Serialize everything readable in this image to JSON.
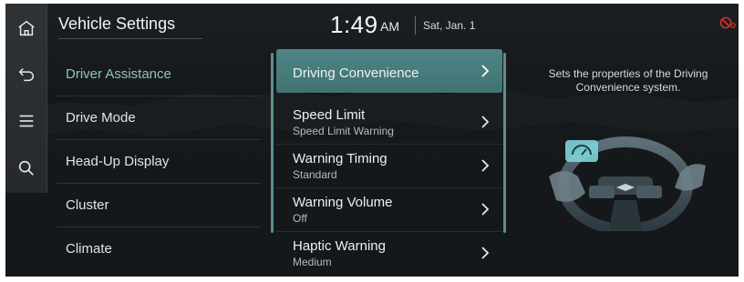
{
  "header": {
    "title": "Vehicle Settings",
    "time": "1:49",
    "ampm": "AM",
    "date": "Sat, Jan. 1",
    "status_icon": "connectivity-off-icon"
  },
  "rail": {
    "items": [
      {
        "name": "home",
        "icon": "home-icon"
      },
      {
        "name": "back",
        "icon": "back-icon"
      },
      {
        "name": "menu",
        "icon": "menu-icon"
      },
      {
        "name": "search",
        "icon": "search-icon"
      }
    ]
  },
  "categories": [
    {
      "label": "Driver Assistance",
      "active": true
    },
    {
      "label": "Drive Mode",
      "active": false
    },
    {
      "label": "Head-Up Display",
      "active": false
    },
    {
      "label": "Cluster",
      "active": false
    },
    {
      "label": "Climate",
      "active": false
    }
  ],
  "sub_items": [
    {
      "label": "Driving Convenience",
      "value": "",
      "active": true
    },
    {
      "label": "Speed Limit",
      "value": "Speed Limit Warning",
      "active": false
    },
    {
      "label": "Warning Timing",
      "value": "Standard",
      "active": false
    },
    {
      "label": "Warning Volume",
      "value": "Off",
      "active": false
    },
    {
      "label": "Haptic Warning",
      "value": "Medium",
      "active": false
    }
  ],
  "description": "Sets the properties of the Driving Convenience system.",
  "colors": {
    "accent": "#4f8586",
    "active_text": "#8fc3c3",
    "status_red": "#d0312d"
  }
}
